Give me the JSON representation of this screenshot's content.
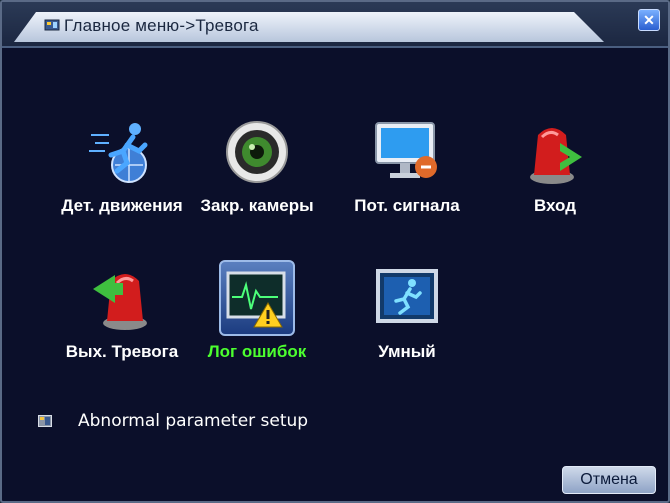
{
  "window": {
    "title": "Главное меню->Тревога",
    "close_symbol": "✕"
  },
  "menu": {
    "items": [
      {
        "label": "Дет. движения",
        "icon": "motion-detect-icon",
        "selected": false
      },
      {
        "label": "Закр. камеры",
        "icon": "camera-blind-icon",
        "selected": false
      },
      {
        "label": "Пот. сигнала",
        "icon": "video-loss-icon",
        "selected": false
      },
      {
        "label": "Вход",
        "icon": "alarm-input-icon",
        "selected": false
      },
      {
        "label": "Вых. Тревога",
        "icon": "alarm-output-icon",
        "selected": false
      },
      {
        "label": "Лог ошибок",
        "icon": "error-log-icon",
        "selected": true
      },
      {
        "label": "Умный",
        "icon": "smart-icon",
        "selected": false
      }
    ]
  },
  "status": {
    "text": "Abnormal parameter setup"
  },
  "buttons": {
    "cancel_label": "Отмена"
  },
  "colors": {
    "background": "#0b0f2a",
    "selected_label": "#4cff2f",
    "label": "#ffffff"
  }
}
